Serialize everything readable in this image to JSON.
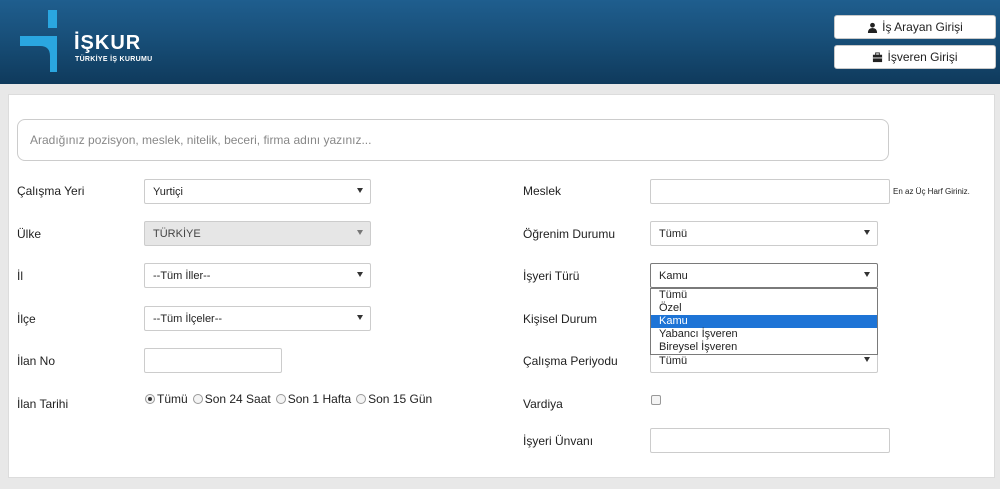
{
  "header": {
    "logo_name": "İŞKUR",
    "logo_sub": "TÜRKİYE İŞ KURUMU",
    "job_seeker_login": "İş Arayan Girişi",
    "employer_login": "İşveren Girişi"
  },
  "search": {
    "placeholder": "Aradığınız pozisyon, meslek, nitelik, beceri, firma adını yazınız..."
  },
  "left": {
    "work_place_label": "Çalışma Yeri",
    "work_place_value": "Yurtiçi",
    "country_label": "Ülke",
    "country_value": "TÜRKİYE",
    "city_label": "İl",
    "city_value": "--Tüm İller--",
    "district_label": "İlçe",
    "district_value": "--Tüm İlçeler--",
    "ad_no_label": "İlan No",
    "ad_date_label": "İlan Tarihi",
    "ad_date_options": [
      "Tümü",
      "Son 24 Saat",
      "Son 1 Hafta",
      "Son 15 Gün"
    ]
  },
  "right": {
    "profession_label": "Meslek",
    "profession_hint": "En az Üç Harf Giriniz.",
    "education_label": "Öğrenim Durumu",
    "education_value": "Tümü",
    "employer_type_label": "İşyeri Türü",
    "employer_type_value": "Kamu",
    "employer_type_options": [
      "Tümü",
      "Özel",
      "Kamu",
      "Yabancı İşveren",
      "Bireysel İşveren"
    ],
    "personal_status_label": "Kişisel Durum",
    "work_period_label": "Çalışma Periyodu",
    "work_period_value": "Tümü",
    "shift_label": "Vardiya",
    "employer_title_label": "İşyeri Ünvanı"
  },
  "colors": {
    "header": "#184f79",
    "accent": "#1a9ad6",
    "selected_option": "#1e74d6"
  }
}
